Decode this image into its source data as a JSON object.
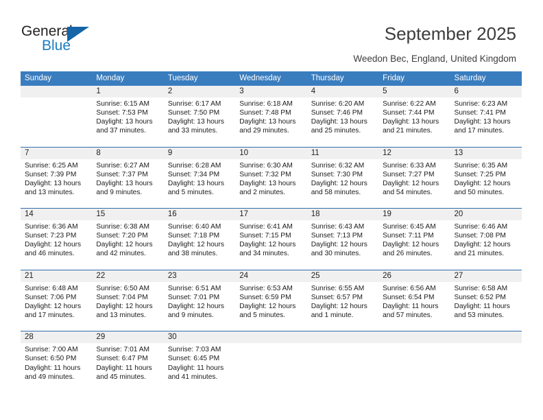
{
  "logo": {
    "word_top": "General",
    "word_bottom": "Blue",
    "triangle_color": "#1565a8",
    "blue_color": "#1a7dc4"
  },
  "header": {
    "title": "September 2025",
    "subtitle": "Weedon Bec, England, United Kingdom"
  },
  "theme": {
    "header_blue": "#3a7dbf",
    "row_divider_blue": "#2f6ca8",
    "daynum_band_gray": "#f0f0f0"
  },
  "weekdays": [
    "Sunday",
    "Monday",
    "Tuesday",
    "Wednesday",
    "Thursday",
    "Friday",
    "Saturday"
  ],
  "weeks": [
    [
      {
        "day": "",
        "sunrise": "",
        "sunset": "",
        "daylight": ""
      },
      {
        "day": "1",
        "sunrise": "Sunrise: 6:15 AM",
        "sunset": "Sunset: 7:53 PM",
        "daylight": "Daylight: 13 hours and 37 minutes."
      },
      {
        "day": "2",
        "sunrise": "Sunrise: 6:17 AM",
        "sunset": "Sunset: 7:50 PM",
        "daylight": "Daylight: 13 hours and 33 minutes."
      },
      {
        "day": "3",
        "sunrise": "Sunrise: 6:18 AM",
        "sunset": "Sunset: 7:48 PM",
        "daylight": "Daylight: 13 hours and 29 minutes."
      },
      {
        "day": "4",
        "sunrise": "Sunrise: 6:20 AM",
        "sunset": "Sunset: 7:46 PM",
        "daylight": "Daylight: 13 hours and 25 minutes."
      },
      {
        "day": "5",
        "sunrise": "Sunrise: 6:22 AM",
        "sunset": "Sunset: 7:44 PM",
        "daylight": "Daylight: 13 hours and 21 minutes."
      },
      {
        "day": "6",
        "sunrise": "Sunrise: 6:23 AM",
        "sunset": "Sunset: 7:41 PM",
        "daylight": "Daylight: 13 hours and 17 minutes."
      }
    ],
    [
      {
        "day": "7",
        "sunrise": "Sunrise: 6:25 AM",
        "sunset": "Sunset: 7:39 PM",
        "daylight": "Daylight: 13 hours and 13 minutes."
      },
      {
        "day": "8",
        "sunrise": "Sunrise: 6:27 AM",
        "sunset": "Sunset: 7:37 PM",
        "daylight": "Daylight: 13 hours and 9 minutes."
      },
      {
        "day": "9",
        "sunrise": "Sunrise: 6:28 AM",
        "sunset": "Sunset: 7:34 PM",
        "daylight": "Daylight: 13 hours and 5 minutes."
      },
      {
        "day": "10",
        "sunrise": "Sunrise: 6:30 AM",
        "sunset": "Sunset: 7:32 PM",
        "daylight": "Daylight: 13 hours and 2 minutes."
      },
      {
        "day": "11",
        "sunrise": "Sunrise: 6:32 AM",
        "sunset": "Sunset: 7:30 PM",
        "daylight": "Daylight: 12 hours and 58 minutes."
      },
      {
        "day": "12",
        "sunrise": "Sunrise: 6:33 AM",
        "sunset": "Sunset: 7:27 PM",
        "daylight": "Daylight: 12 hours and 54 minutes."
      },
      {
        "day": "13",
        "sunrise": "Sunrise: 6:35 AM",
        "sunset": "Sunset: 7:25 PM",
        "daylight": "Daylight: 12 hours and 50 minutes."
      }
    ],
    [
      {
        "day": "14",
        "sunrise": "Sunrise: 6:36 AM",
        "sunset": "Sunset: 7:23 PM",
        "daylight": "Daylight: 12 hours and 46 minutes."
      },
      {
        "day": "15",
        "sunrise": "Sunrise: 6:38 AM",
        "sunset": "Sunset: 7:20 PM",
        "daylight": "Daylight: 12 hours and 42 minutes."
      },
      {
        "day": "16",
        "sunrise": "Sunrise: 6:40 AM",
        "sunset": "Sunset: 7:18 PM",
        "daylight": "Daylight: 12 hours and 38 minutes."
      },
      {
        "day": "17",
        "sunrise": "Sunrise: 6:41 AM",
        "sunset": "Sunset: 7:15 PM",
        "daylight": "Daylight: 12 hours and 34 minutes."
      },
      {
        "day": "18",
        "sunrise": "Sunrise: 6:43 AM",
        "sunset": "Sunset: 7:13 PM",
        "daylight": "Daylight: 12 hours and 30 minutes."
      },
      {
        "day": "19",
        "sunrise": "Sunrise: 6:45 AM",
        "sunset": "Sunset: 7:11 PM",
        "daylight": "Daylight: 12 hours and 26 minutes."
      },
      {
        "day": "20",
        "sunrise": "Sunrise: 6:46 AM",
        "sunset": "Sunset: 7:08 PM",
        "daylight": "Daylight: 12 hours and 21 minutes."
      }
    ],
    [
      {
        "day": "21",
        "sunrise": "Sunrise: 6:48 AM",
        "sunset": "Sunset: 7:06 PM",
        "daylight": "Daylight: 12 hours and 17 minutes."
      },
      {
        "day": "22",
        "sunrise": "Sunrise: 6:50 AM",
        "sunset": "Sunset: 7:04 PM",
        "daylight": "Daylight: 12 hours and 13 minutes."
      },
      {
        "day": "23",
        "sunrise": "Sunrise: 6:51 AM",
        "sunset": "Sunset: 7:01 PM",
        "daylight": "Daylight: 12 hours and 9 minutes."
      },
      {
        "day": "24",
        "sunrise": "Sunrise: 6:53 AM",
        "sunset": "Sunset: 6:59 PM",
        "daylight": "Daylight: 12 hours and 5 minutes."
      },
      {
        "day": "25",
        "sunrise": "Sunrise: 6:55 AM",
        "sunset": "Sunset: 6:57 PM",
        "daylight": "Daylight: 12 hours and 1 minute."
      },
      {
        "day": "26",
        "sunrise": "Sunrise: 6:56 AM",
        "sunset": "Sunset: 6:54 PM",
        "daylight": "Daylight: 11 hours and 57 minutes."
      },
      {
        "day": "27",
        "sunrise": "Sunrise: 6:58 AM",
        "sunset": "Sunset: 6:52 PM",
        "daylight": "Daylight: 11 hours and 53 minutes."
      }
    ],
    [
      {
        "day": "28",
        "sunrise": "Sunrise: 7:00 AM",
        "sunset": "Sunset: 6:50 PM",
        "daylight": "Daylight: 11 hours and 49 minutes."
      },
      {
        "day": "29",
        "sunrise": "Sunrise: 7:01 AM",
        "sunset": "Sunset: 6:47 PM",
        "daylight": "Daylight: 11 hours and 45 minutes."
      },
      {
        "day": "30",
        "sunrise": "Sunrise: 7:03 AM",
        "sunset": "Sunset: 6:45 PM",
        "daylight": "Daylight: 11 hours and 41 minutes."
      },
      {
        "day": "",
        "sunrise": "",
        "sunset": "",
        "daylight": ""
      },
      {
        "day": "",
        "sunrise": "",
        "sunset": "",
        "daylight": ""
      },
      {
        "day": "",
        "sunrise": "",
        "sunset": "",
        "daylight": ""
      },
      {
        "day": "",
        "sunrise": "",
        "sunset": "",
        "daylight": ""
      }
    ]
  ]
}
